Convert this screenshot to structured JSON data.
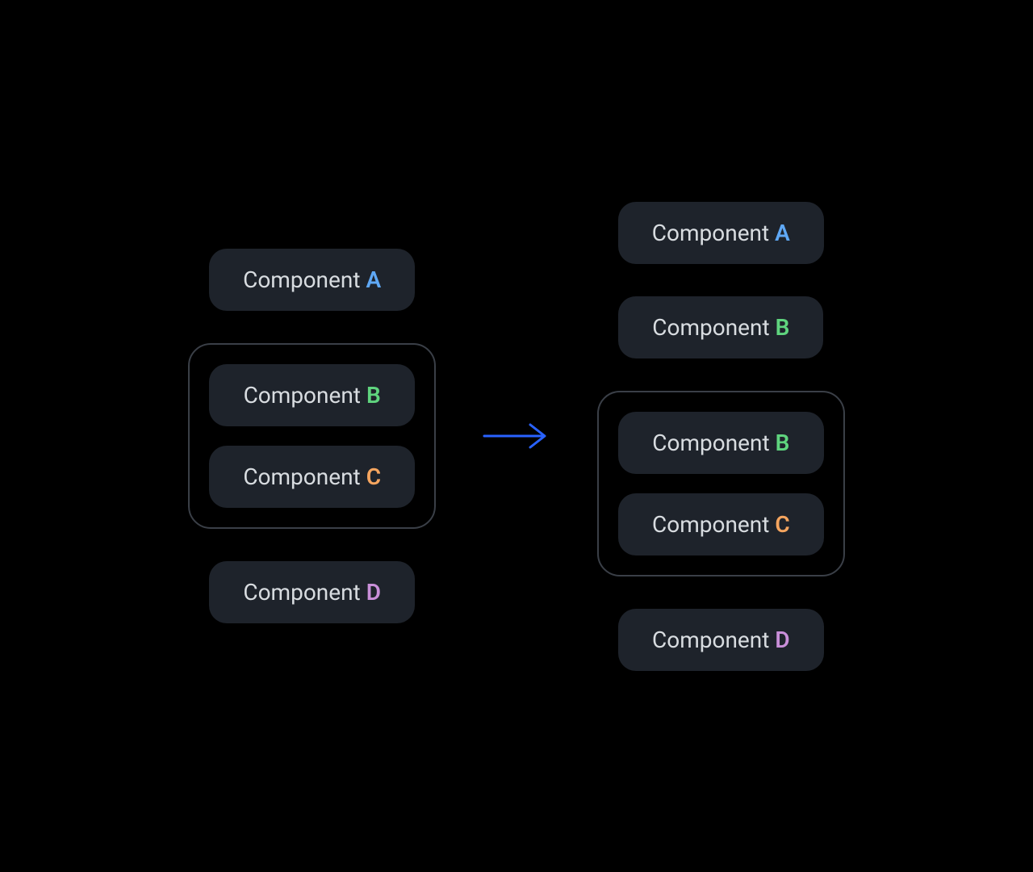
{
  "components": {
    "label_prefix": "Component",
    "a": "A",
    "b": "B",
    "c": "C",
    "d": "D"
  },
  "colors": {
    "a": "#5fa8f5",
    "b": "#5fd47e",
    "c": "#f5a55f",
    "d": "#c98fd9",
    "arrow": "#2962ff"
  },
  "left_column": [
    {
      "type": "component",
      "id": "a"
    },
    {
      "type": "group",
      "children": [
        {
          "type": "component",
          "id": "b"
        },
        {
          "type": "component",
          "id": "c"
        }
      ]
    },
    {
      "type": "component",
      "id": "d"
    }
  ],
  "right_column": [
    {
      "type": "component",
      "id": "a"
    },
    {
      "type": "component",
      "id": "b"
    },
    {
      "type": "group",
      "children": [
        {
          "type": "component",
          "id": "b"
        },
        {
          "type": "component",
          "id": "c"
        }
      ]
    },
    {
      "type": "component",
      "id": "d"
    }
  ]
}
